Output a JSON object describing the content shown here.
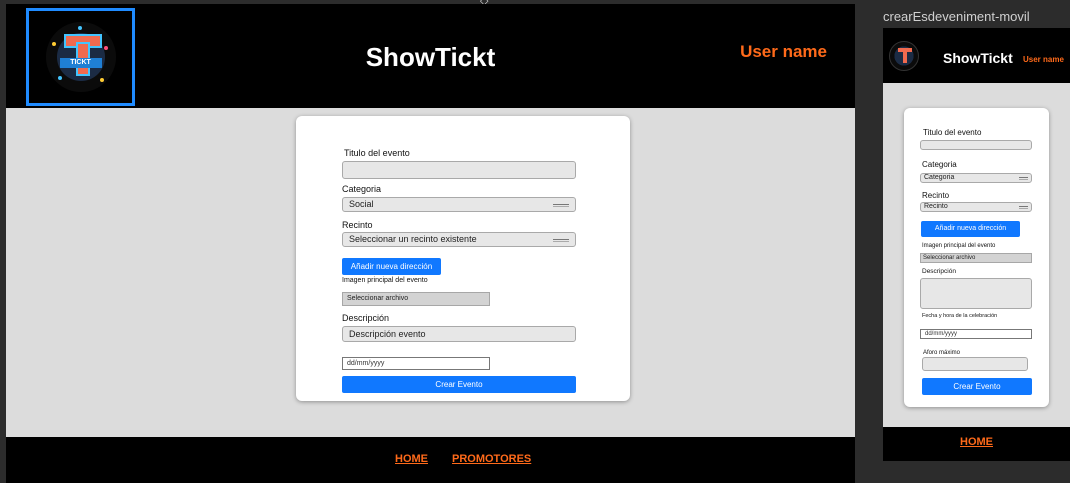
{
  "desktop": {
    "title": "ShowTickt",
    "user": "User name",
    "logo_text": "TICKT",
    "form": {
      "titulo_label": "Titulo del evento",
      "titulo_value": "",
      "categoria_label": "Categoria",
      "categoria_value": "Social",
      "recinto_label": "Recinto",
      "recinto_value": "Seleccionar un recinto existente",
      "add_direccion": "Añadir nueva dirección",
      "imagen_label": "Imagen principal del evento",
      "imagen_value": "Seleccionar archivo",
      "descripcion_label": "Descripción",
      "descripcion_value": "Descripción evento",
      "fecha_value": "dd/mm/yyyy",
      "submit": "Crear Evento"
    },
    "footer": {
      "home": "HOME",
      "promotores": "PROMOTORES"
    }
  },
  "mobile": {
    "frame_name": "crearEsdeveniment-movil",
    "title": "ShowTickt",
    "user": "User name",
    "form": {
      "titulo_label": "Titulo del evento",
      "titulo_value": "",
      "categoria_label": "Categoria",
      "categoria_value": "Categoria",
      "recinto_label": "Recinto",
      "recinto_value": "Recinto",
      "add_direccion": "Añadir nueva dirección",
      "imagen_label": "Imagen principal del evento",
      "imagen_value": "Seleccionar archivo",
      "descripcion_label": "Descripción",
      "fecha_label": "Fecha y hora de la celebración",
      "fecha_value": "dd/mm/yyyy",
      "aforo_label": "Aforo máximo",
      "submit": "Crear Evento"
    },
    "footer": {
      "home": "HOME"
    }
  },
  "colors": {
    "accent": "#ff6a1a",
    "button": "#1078ff",
    "frame_bg": "#dcdcdc",
    "header_bg": "#000000"
  }
}
